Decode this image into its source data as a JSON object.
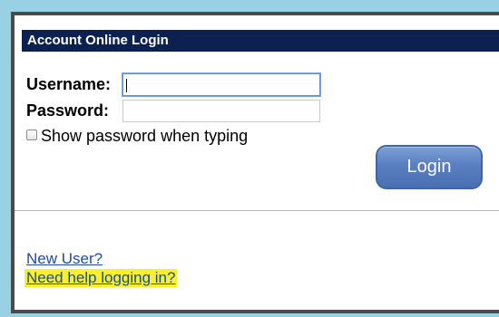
{
  "login": {
    "title": "Account Online Login",
    "username_label": "Username:",
    "username_value": "",
    "password_label": "Password:",
    "password_value": "",
    "show_password_label": "Show password when typing",
    "show_password_checked": false,
    "login_button_label": "Login"
  },
  "links": {
    "new_user": "New User?",
    "need_help": "Need help logging in?"
  },
  "colors": {
    "page_background": "#99d1e4",
    "header_background": "#0c2150",
    "header_text": "#ffffff",
    "button_background": "#5a7fc1",
    "link_color": "#1a4d9e",
    "highlight": "#f7f02a"
  }
}
